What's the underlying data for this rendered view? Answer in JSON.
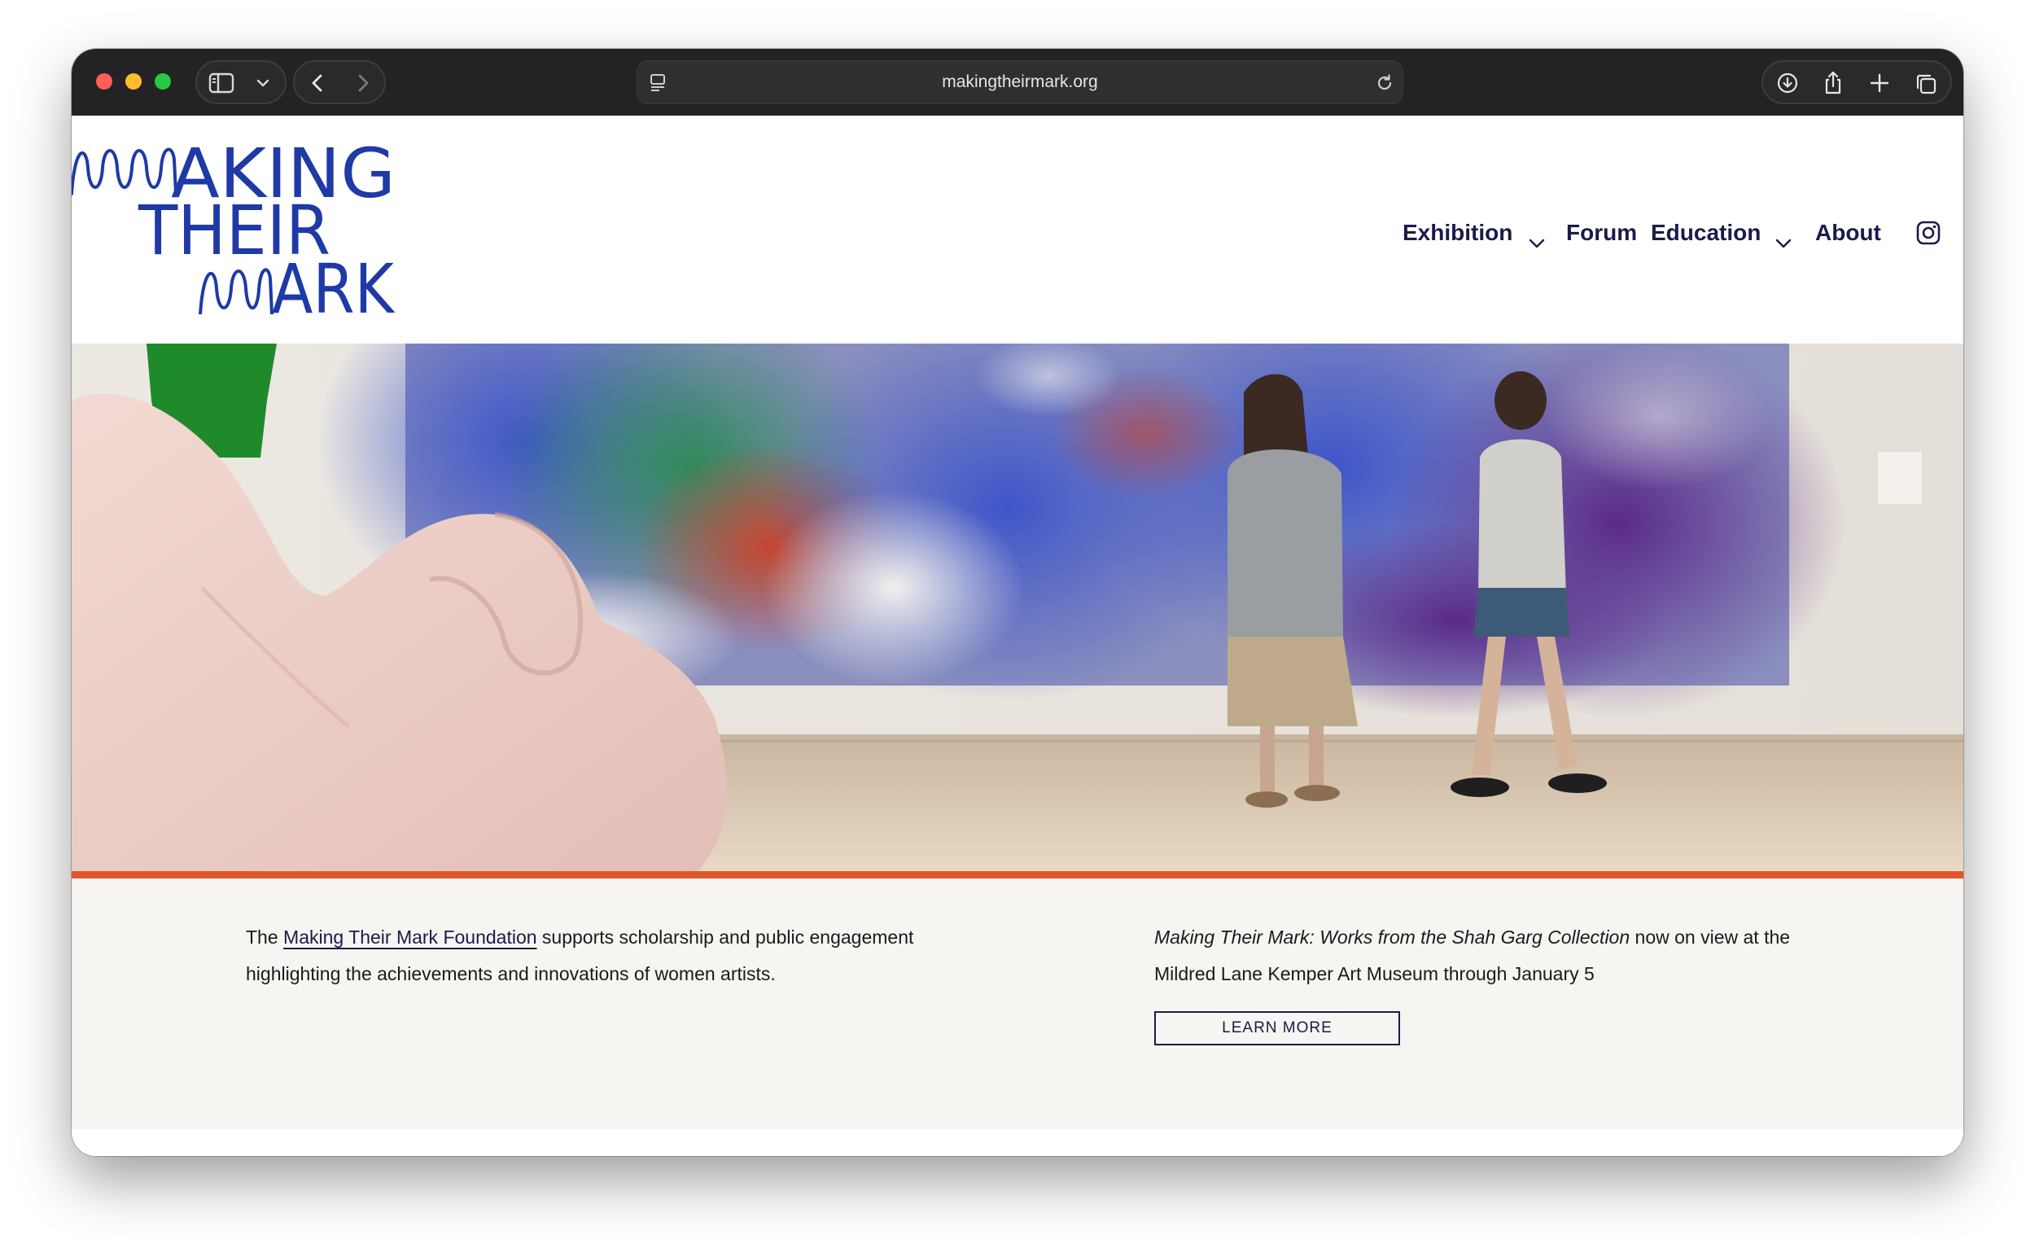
{
  "browser": {
    "url": "makingtheirmark.org",
    "icons": [
      "sidebar-icon",
      "chevron-down-icon",
      "back-arrow-icon",
      "forward-arrow-icon",
      "reader-icon",
      "reload-icon",
      "download-icon",
      "share-icon",
      "new-tab-icon",
      "tabs-overview-icon"
    ]
  },
  "site": {
    "logo_lines": [
      "MAKING",
      "THEIR",
      "MARK"
    ],
    "nav": {
      "exhibition": "Exhibition",
      "forum": "Forum",
      "education": "Education",
      "about": "About",
      "instagram_icon": "instagram-icon"
    },
    "colors": {
      "logo": "#1f3aa6",
      "nav_text": "#1b1b4a",
      "accent_bar": "#e2572b",
      "info_background": "#f6f5f2"
    }
  },
  "intro": {
    "prefix": "The ",
    "link": "Making Their Mark Foundation",
    "suffix": " supports scholarship and public engagement highlighting the achievements and innovations of women artists."
  },
  "exhibit": {
    "title": "Making Their Mark: Works from the Shah Garg Collection",
    "suffix": " now on view at the Mildred Lane Kemper Art Museum through January 5",
    "button": "LEARN MORE"
  }
}
